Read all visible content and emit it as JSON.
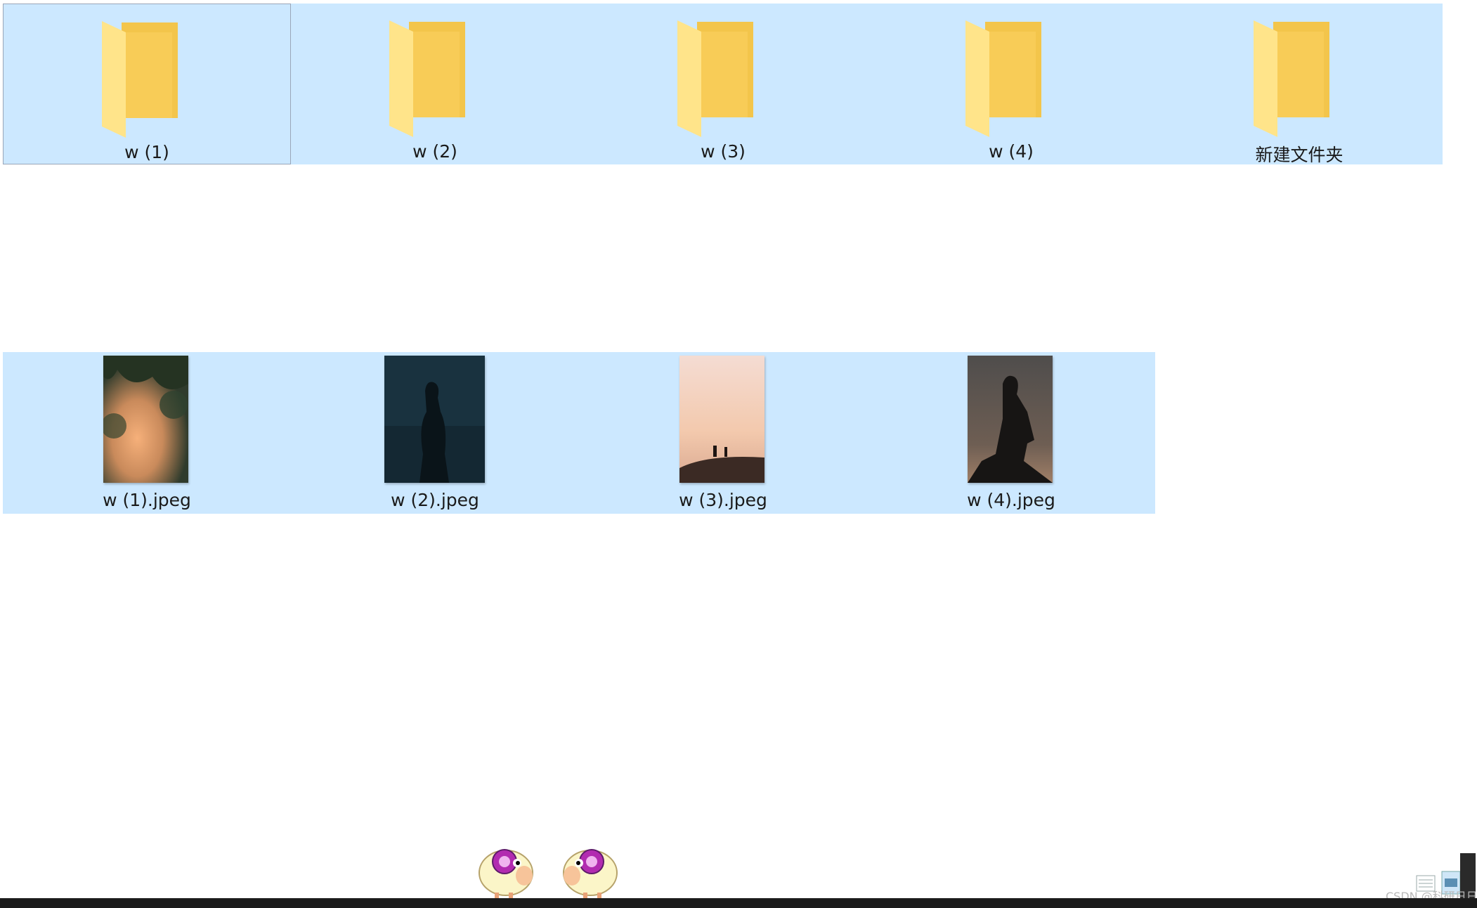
{
  "folders": [
    {
      "name": "w (1)",
      "selected": true,
      "focused": true
    },
    {
      "name": "w (2)",
      "selected": true
    },
    {
      "name": "w (3)",
      "selected": true
    },
    {
      "name": "w (4)",
      "selected": true
    },
    {
      "name": "新建文件夹",
      "selected": true
    }
  ],
  "images": [
    {
      "name": "w (1).jpeg",
      "selected": true,
      "thumbnail": "orange-sunset-through-leaves"
    },
    {
      "name": "w (2).jpeg",
      "selected": true,
      "thumbnail": "silhouette-woman-by-sea-blue"
    },
    {
      "name": "w (3).jpeg",
      "selected": true,
      "thumbnail": "two-figures-on-hill-at-dusk"
    },
    {
      "name": "w (4).jpeg",
      "selected": true,
      "thumbnail": "silhouette-woman-sitting-dusk"
    }
  ],
  "colors": {
    "selection": "#cce8ff",
    "focus_border": "#99a6b8",
    "folder_front": "#ffd766",
    "folder_back": "#f5c44a"
  },
  "icons": [
    "folder-icon",
    "sheep-icon",
    "tray-icon"
  ],
  "watermark": "CSDN @科研日日"
}
